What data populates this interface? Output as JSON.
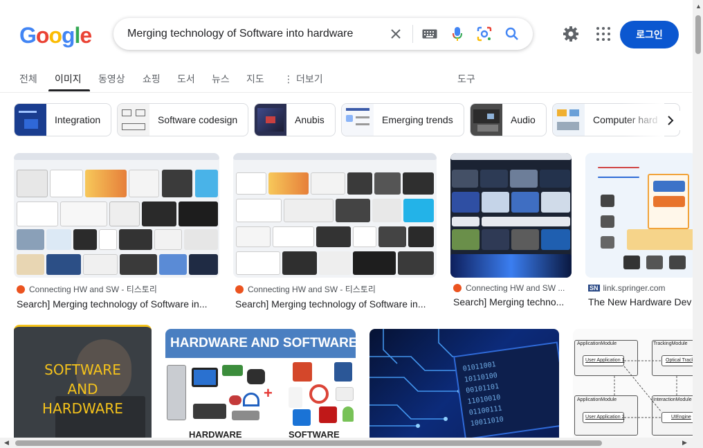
{
  "logo": {
    "letters": [
      "G",
      "o",
      "o",
      "g",
      "l",
      "e"
    ],
    "colors": [
      "#4285f4",
      "#ea4335",
      "#fbbc05",
      "#4285f4",
      "#34a853",
      "#ea4335"
    ]
  },
  "search": {
    "value": "Merging technology of Software into hardware",
    "icons": [
      "clear-icon",
      "keyboard-icon",
      "microphone-icon",
      "lens-icon",
      "search-icon"
    ]
  },
  "header": {
    "login_label": "로그인",
    "accent": "#0b57d0"
  },
  "tabs": [
    {
      "label": "전체"
    },
    {
      "label": "이미지"
    },
    {
      "label": "동영상"
    },
    {
      "label": "쇼핑"
    },
    {
      "label": "도서"
    },
    {
      "label": "뉴스"
    },
    {
      "label": "지도"
    },
    {
      "label": "더보기"
    }
  ],
  "tools_label": "도구",
  "chips": [
    {
      "label": "Integration"
    },
    {
      "label": "Software codesign"
    },
    {
      "label": "Anubis"
    },
    {
      "label": "Emerging trends"
    },
    {
      "label": "Audio"
    },
    {
      "label": "Computer hard"
    }
  ],
  "results_row1": [
    {
      "source": "Connecting HW and SW - 티스토리",
      "title": "Search] Merging technology of Software in..."
    },
    {
      "source": "Connecting HW and SW - 티스토리",
      "title": "Search] Merging technology of Software in..."
    },
    {
      "source": "Connecting HW and SW ...",
      "title": "Search] Merging techno..."
    },
    {
      "source": "link.springer.com",
      "source_badge": "SN",
      "title": "The New Hardware Dev"
    }
  ],
  "results_row2": [
    {
      "overlay_lines": [
        "SOFTWARE",
        "AND",
        "HARDWARE"
      ]
    },
    {
      "banner": "HARDWARE AND SOFTWARE",
      "bottom_left": "HARDWARE",
      "bottom_right": "SOFTWARE"
    },
    {
      "caption": ""
    },
    {
      "modules": [
        "ApplicationModule",
        "TrackingModule",
        "ApplicationModule",
        "InteractionModule"
      ],
      "items": [
        "User Application 1",
        "Optical Track",
        "User Application 2",
        "UIEngine"
      ]
    }
  ]
}
